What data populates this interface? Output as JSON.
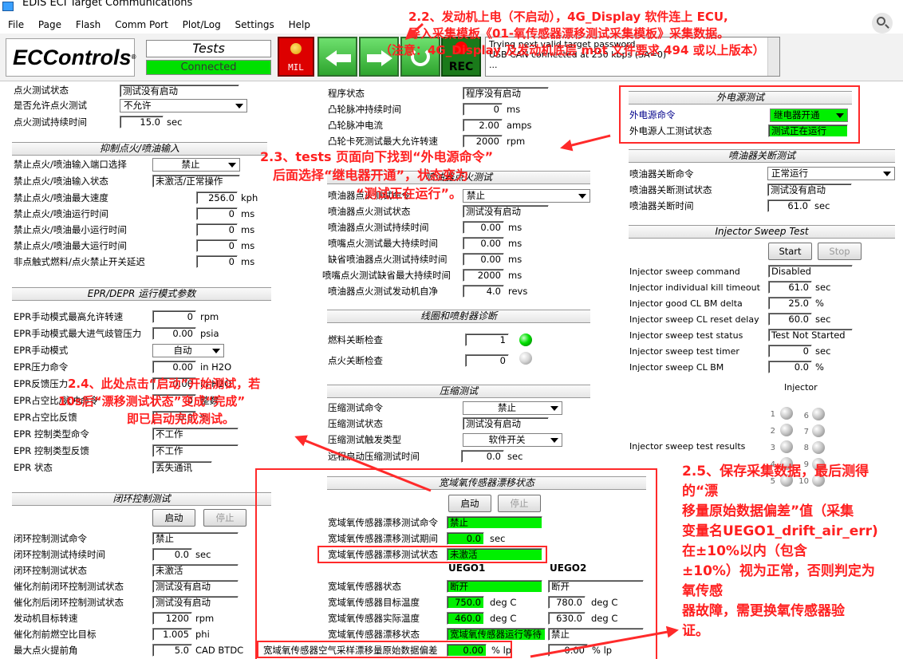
{
  "window": {
    "title": "EDIS ECI Target Communications"
  },
  "menu": [
    "File",
    "Page",
    "Flash",
    "Comm Port",
    "Plot/Log",
    "Settings",
    "Help"
  ],
  "header": {
    "logo": "ECControls",
    "logo_mark": "®",
    "page_name": "Tests",
    "status": "Connected",
    "mil": "MIL",
    "rec": "REC",
    "log": [
      "Trying next valid target password...",
      "USB CAN connected at 250 kbps (SA=0)",
      "..."
    ]
  },
  "colors": {
    "accent": "#00f000",
    "annotation": "#ff2020"
  },
  "ignition": {
    "rows": [
      {
        "label": "点火测试状态",
        "value": "测试没有启动"
      },
      {
        "label": "是否允许点火测试",
        "value": "不允许"
      },
      {
        "label": "点火测试持续时间",
        "value": "15.0",
        "unit": "sec"
      }
    ]
  },
  "suppress": {
    "title": "抑制点火/喷油输入",
    "rows": [
      {
        "label": "禁止点火/喷油输入端口选择",
        "value": "禁止"
      },
      {
        "label": "禁止点火/喷油输入状态",
        "value": "未激活/正常操作"
      },
      {
        "label": "禁止点火/喷油最大速度",
        "value": "256.0",
        "unit": "kph"
      },
      {
        "label": "禁止点火/喷油运行时间",
        "value": "0",
        "unit": "ms"
      },
      {
        "label": "禁止点火/喷油最小运行时间",
        "value": "0",
        "unit": "ms"
      },
      {
        "label": "禁止点火/喷油最大运行时间",
        "value": "0",
        "unit": "ms"
      },
      {
        "label": "非点触式燃料/点火禁止开关延迟",
        "value": "0",
        "unit": "ms"
      }
    ]
  },
  "epr": {
    "title": "EPR/DEPR 运行模式参数",
    "rows": [
      {
        "label": "EPR手动模式最高允许转速",
        "value": "0",
        "unit": "rpm"
      },
      {
        "label": "EPR手动模式最大进气歧管压力",
        "value": "0.00",
        "unit": "psia"
      },
      {
        "label": "EPR手动模式",
        "value": "自动"
      },
      {
        "label": "EPR压力命令",
        "value": "0.00",
        "unit": "in H2O"
      },
      {
        "label": "EPR反馈压力",
        "value": "0.00",
        "unit": "in H2O"
      },
      {
        "label": "EPR占空比/脉冲命令",
        "value": "0",
        "unit": "整数"
      },
      {
        "label": "EPR占空比反馈",
        "value": "0.0",
        "unit": "%"
      },
      {
        "label": "EPR 控制类型命令",
        "value": "不工作"
      },
      {
        "label": "EPR 控制类型反馈",
        "value": "不工作"
      },
      {
        "label": "EPR 状态",
        "value": "丢失通讯"
      }
    ]
  },
  "closed_loop": {
    "title": "闭环控制测试",
    "start": "启动",
    "stop": "停止",
    "rows": [
      {
        "label": "闭环控制测试命令",
        "value": "禁止"
      },
      {
        "label": "闭环控制测试持续时间",
        "value": "0.0",
        "unit": "sec"
      },
      {
        "label": "闭环控制测试状态",
        "value": "未激活"
      },
      {
        "label": "催化剂前闭环控制测试状态",
        "value": "测试没有启动"
      },
      {
        "label": "催化剂后闭环控制测试状态",
        "value": "测试没有启动"
      },
      {
        "label": "发动机目标转速",
        "value": "1200",
        "unit": "rpm"
      },
      {
        "label": "催化剂前燃空比目标",
        "value": "1.005",
        "unit": "phi"
      },
      {
        "label": "最大点火提前角",
        "value": "5.0",
        "unit": "CAD BTDC"
      }
    ]
  },
  "program": {
    "rows": [
      {
        "label": "程序状态",
        "value": "程序没有启动"
      },
      {
        "label": "凸轮脉冲持续时间",
        "value": "0",
        "unit": "ms"
      },
      {
        "label": "凸轮脉冲电流",
        "value": "2.00",
        "unit": "amps"
      },
      {
        "label": "凸轮卡死测试最大允许转速",
        "value": "2000",
        "unit": "rpm"
      }
    ]
  },
  "injector_fire": {
    "title": "喷油器点火测试",
    "rows": [
      {
        "label": "喷油器点火测试命令",
        "value": "禁止"
      },
      {
        "label": "喷油器点火测试状态",
        "value": "测试没有启动"
      },
      {
        "label": "喷油器点火测试持续时间",
        "value": "0.00",
        "unit": "ms"
      },
      {
        "label": "喷嘴点火测试最大持续时间",
        "value": "0.00",
        "unit": "ms"
      },
      {
        "label": "缺省喷油器点火测试持续时间",
        "value": "0.00",
        "unit": "ms"
      },
      {
        "label": "喷嘴点火测试缺省最大持续时间",
        "value": "2000",
        "unit": "ms"
      },
      {
        "label": "喷油器点火测试发动机自净",
        "value": "4.0",
        "unit": "revs"
      }
    ]
  },
  "coil_diag": {
    "title": "线圈和喷射器诊断",
    "rows": [
      {
        "label": "燃料关断检查",
        "value": "1"
      },
      {
        "label": "点火关断检查",
        "value": "0"
      }
    ]
  },
  "compression": {
    "title": "压缩测试",
    "rows": [
      {
        "label": "压缩测试命令",
        "value": "禁止"
      },
      {
        "label": "压缩测试状态",
        "value": "测试没有启动"
      },
      {
        "label": "压缩测试触发类型",
        "value": "软件开关"
      },
      {
        "label": "远程启动压缩测试时间",
        "value": "0.0",
        "unit": "sec"
      }
    ]
  },
  "uego": {
    "title": "宽域氧传感器漂移状态",
    "start": "启动",
    "stop": "停止",
    "rows": [
      {
        "label": "宽域氧传感器漂移测试命令",
        "value": "禁止"
      },
      {
        "label": "宽域氧传感器漂移测试期间",
        "value": "0.0",
        "unit": "sec"
      },
      {
        "label": "宽域氧传感器漂移测试状态",
        "value": "未激活"
      }
    ],
    "col1": "UEGO1",
    "col2": "UEGO2",
    "grid": [
      {
        "label": "宽域氧传感器状态",
        "v1": "断开",
        "v2": "断开"
      },
      {
        "label": "宽域氧传感器目标温度",
        "v1": "750.0",
        "u1": "deg C",
        "v2": "780.0",
        "u2": "deg C"
      },
      {
        "label": "宽域氧传感器实际温度",
        "v1": "460.0",
        "u1": "deg C",
        "v2": "630.0",
        "u2": "deg C"
      },
      {
        "label": "宽域氧传感器漂移状态",
        "v1": "宽域氧传感器运行等待",
        "v2": "禁止"
      },
      {
        "label": "宽域氧传感器空气采样漂移量原始数据偏差",
        "v1": "0.00",
        "u1": "% lp",
        "v2": "0.00",
        "u2": "% lp"
      }
    ]
  },
  "ext_power": {
    "title": "外电源测试",
    "rows": [
      {
        "label": "外电源命令",
        "value": "继电器开通"
      },
      {
        "label": "外电源人工测试状态",
        "value": "测试正在运行"
      }
    ]
  },
  "inj_kill": {
    "title": "喷油器关断测试",
    "rows": [
      {
        "label": "喷油器关断命令",
        "value": "正常运行"
      },
      {
        "label": "喷油器关断测试状态",
        "value": "测试没有启动"
      },
      {
        "label": "喷油器关断时间",
        "value": "61.0",
        "unit": "sec"
      }
    ]
  },
  "sweep": {
    "title": "Injector Sweep Test",
    "start": "Start",
    "stop": "Stop",
    "rows": [
      {
        "label": "Injector sweep command",
        "value": "Disabled"
      },
      {
        "label": "Injector individual kill timeout",
        "value": "61.0",
        "unit": "sec"
      },
      {
        "label": "Injector good CL BM delta",
        "value": "25.0",
        "unit": "%"
      },
      {
        "label": "Injector sweep CL reset delay",
        "value": "60.0",
        "unit": "sec"
      },
      {
        "label": "Injector sweep test status",
        "value": "Test Not Started"
      },
      {
        "label": "Injector sweep test timer",
        "value": "0",
        "unit": "sec"
      },
      {
        "label": "Injector sweep CL BM",
        "value": "0.0",
        "unit": "%"
      }
    ],
    "injector_label": "Injector",
    "results_label": "Injector sweep test results",
    "inj_nums": [
      "1",
      "2",
      "3",
      "4",
      "5",
      "6",
      "7",
      "8",
      "9",
      "10"
    ]
  },
  "annotations": {
    "a22": [
      "2.2、发动机上电（不启动），4G_Display 软件连上 ECU,",
      "导入采集模板《01-氧传感器漂移测试采集模板》采集数据。",
      "（注意：4G_Display 及发动机底层 mot 文件要求 494 或以上版本）"
    ],
    "a23": [
      "2.3、tests 页面向下找到“外电源命令”",
      "后面选择“继电器开通”，状态变为",
      "“测试正在运行”。"
    ],
    "a24": [
      "2.4、此处点击“启动”开始测试，若",
      "10s后“漂移测试状态”变成“完成”",
      "即已启动完成测试。"
    ],
    "a25": [
      "2.5、保存采集数据，最后测得",
      "的“漂",
      "移量原始数据偏差”值（采集",
      "变量名UEGO1_drift_air_err)",
      "在±10%以内（包含",
      "±10%）视为正常，否则判定为",
      "氧传感",
      "器故障，需更换氧传感器验",
      "证。"
    ]
  }
}
